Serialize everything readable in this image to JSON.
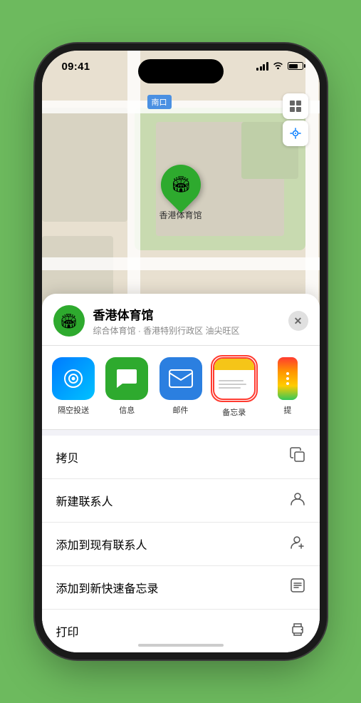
{
  "status": {
    "time": "09:41",
    "location_icon": "▶"
  },
  "map": {
    "label": "南口",
    "pin_label": "香港体育馆",
    "pin_emoji": "🏟"
  },
  "map_controls": {
    "map_btn": "🗺",
    "location_btn": "➤"
  },
  "venue": {
    "name": "香港体育馆",
    "subtitle": "综合体育馆 · 香港特别行政区 油尖旺区",
    "close_label": "✕"
  },
  "share_items": [
    {
      "label": "隔空投送",
      "type": "airdrop"
    },
    {
      "label": "信息",
      "type": "message"
    },
    {
      "label": "邮件",
      "type": "mail"
    },
    {
      "label": "备忘录",
      "type": "notes"
    },
    {
      "label": "提",
      "type": "more"
    }
  ],
  "actions": [
    {
      "label": "拷贝",
      "icon": "📋"
    },
    {
      "label": "新建联系人",
      "icon": "👤"
    },
    {
      "label": "添加到现有联系人",
      "icon": "👤"
    },
    {
      "label": "添加到新快速备忘录",
      "icon": "📝"
    },
    {
      "label": "打印",
      "icon": "🖨"
    }
  ]
}
